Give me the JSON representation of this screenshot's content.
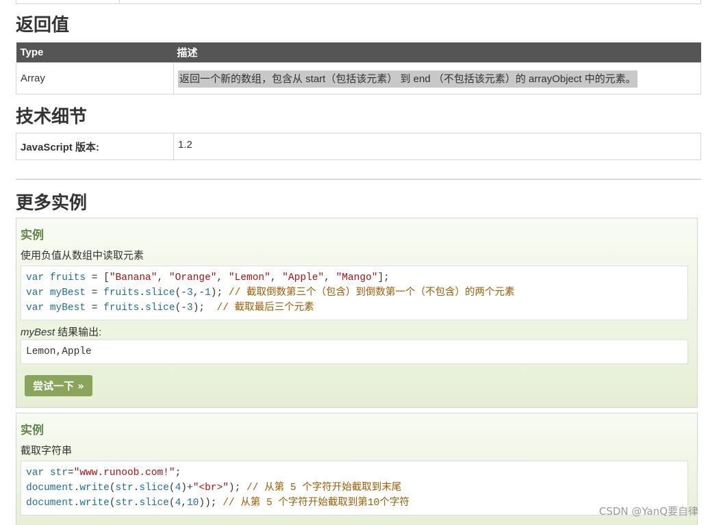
{
  "return_value": {
    "heading": "返回值",
    "headers": [
      "Type",
      "描述"
    ],
    "row": {
      "type": "Array",
      "desc": "返回一个新的数组，包含从 start（包括该元素） 到 end （不包括该元素）的 arrayObject 中的元素。"
    }
  },
  "tech": {
    "heading": "技术细节",
    "key": "JavaScript 版本:",
    "value": "1.2"
  },
  "more": {
    "heading": "更多实例"
  },
  "example1": {
    "title": "实例",
    "desc": "使用负值从数组中读取元素",
    "code_lines": [
      "var fruits = [\"Banana\", \"Orange\", \"Lemon\", \"Apple\", \"Mango\"];",
      "var myBest = fruits.slice(-3,-1); // 截取倒数第三个（包含）到倒数第一个（不包含）的两个元素",
      "var myBest = fruits.slice(-3);  // 截取最后三个元素"
    ],
    "output_var": "myBest",
    "output_label": " 结果输出:",
    "output": "Lemon,Apple",
    "try_label": "尝试一下 »"
  },
  "example2": {
    "title": "实例",
    "desc": "截取字符串",
    "code_lines": [
      "var str=\"www.runoob.com!\";",
      "document.write(str.slice(4)+\"<br>\"); // 从第 5 个字符开始截取到末尾",
      "document.write(str.slice(4,10)); // 从第 5 个字符开始截取到第10个字符"
    ]
  },
  "watermark": "CSDN @YanQ要自律"
}
